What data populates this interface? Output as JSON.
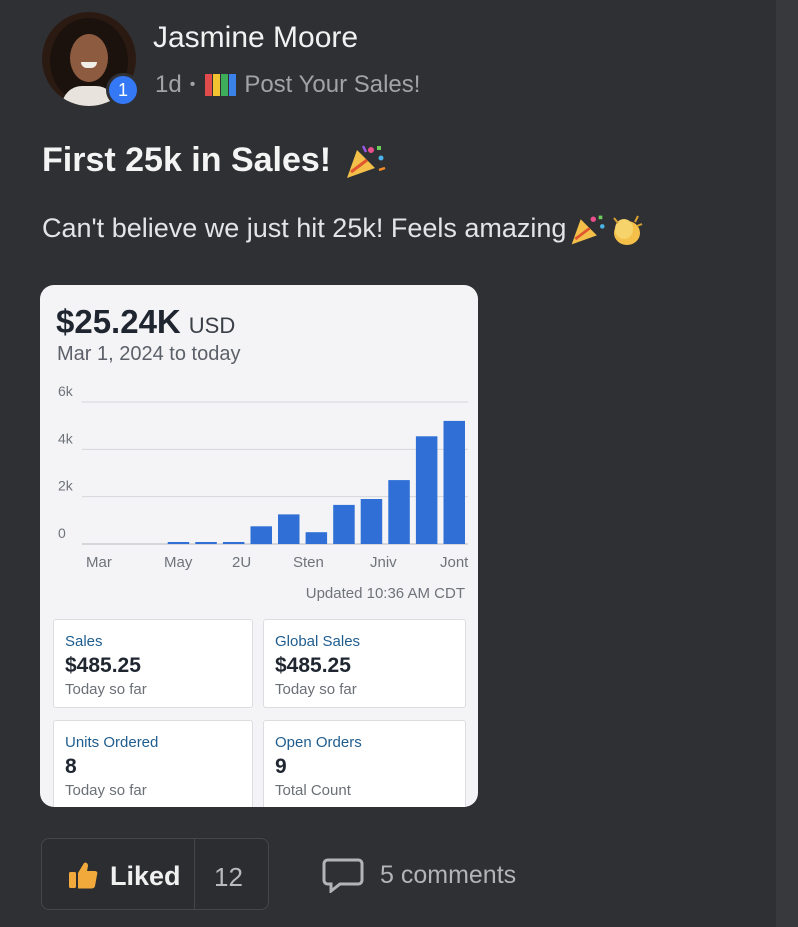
{
  "post": {
    "author": "Jasmine Moore",
    "badge_count": "1",
    "time": "1d",
    "separator": "•",
    "group": "Post Your Sales!",
    "title": "First 25k in Sales!",
    "body": "Can't believe we just hit 25k! Feels amazing"
  },
  "card": {
    "amount": "$25.24K",
    "currency": "USD",
    "range": "Mar 1, 2024 to today",
    "updated": "Updated 10:36 AM CDT",
    "tiles": [
      {
        "label": "Sales",
        "value": "$485.25",
        "sub": "Today so far"
      },
      {
        "label": "Global Sales",
        "value": "$485.25",
        "sub": "Today so far"
      },
      {
        "label": "Units Ordered",
        "value": "8",
        "sub": "Today so far"
      },
      {
        "label": "Open Orders",
        "value": "9",
        "sub": "Total Count"
      }
    ]
  },
  "chart_data": {
    "type": "bar",
    "title": "",
    "xlabel": "",
    "ylabel": "",
    "ylim": [
      0,
      6000
    ],
    "y_ticks": [
      "0",
      "2k",
      "4k",
      "6k"
    ],
    "x_tick_labels": [
      "Mar",
      "May",
      "2U",
      "Sten",
      "Jniv",
      "Jont"
    ],
    "values": [
      0,
      0,
      0,
      30,
      60,
      80,
      750,
      1250,
      500,
      1650,
      1900,
      2700,
      4550,
      5200
    ],
    "grid": true,
    "bar_color": "#2f6fd6"
  },
  "actions": {
    "like_label": "Liked",
    "like_count": "12",
    "comments_label": "5 comments"
  },
  "colors": {
    "background": "#2f3033",
    "accent": "#3478f6",
    "card": "#f4f4f6"
  },
  "icons": {
    "group": "bar-chart-icon",
    "party": "party-popper-emoji",
    "clap": "clapping-hands-emoji",
    "like": "thumbs-up-icon",
    "comment": "comment-bubble-icon"
  }
}
